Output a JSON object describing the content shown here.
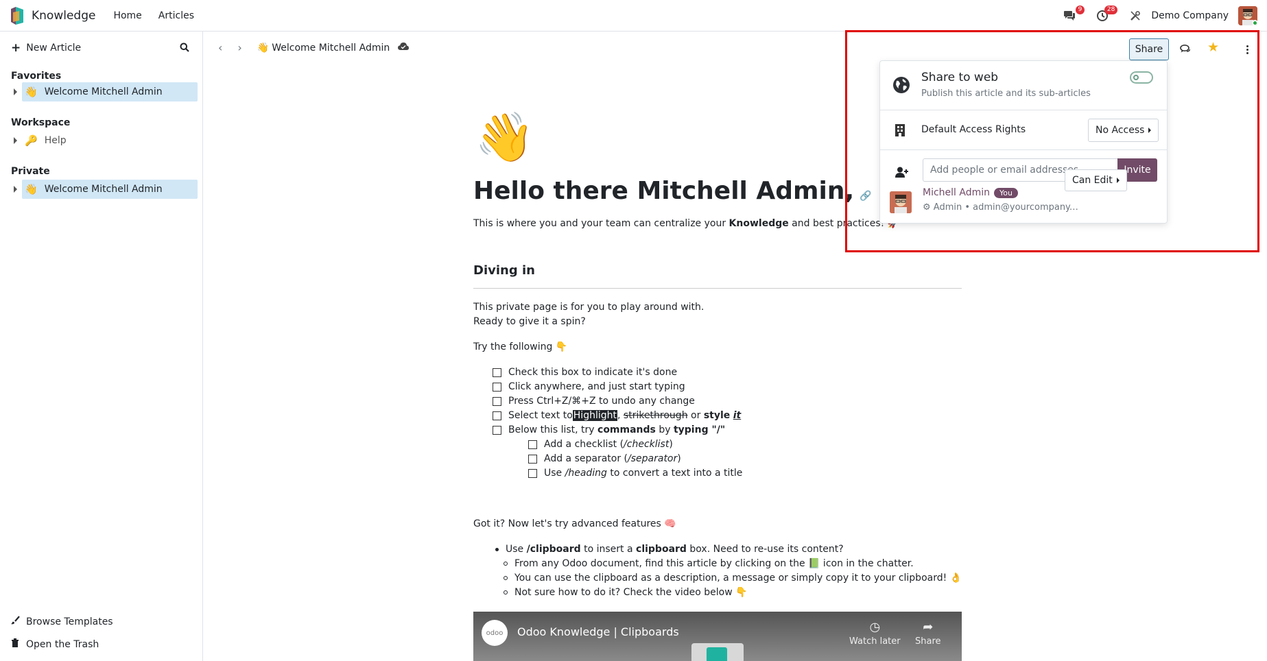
{
  "app": {
    "name": "Knowledge",
    "nav": [
      "Home",
      "Articles"
    ],
    "notifications": {
      "messages_count": "9",
      "activities_count": "28"
    },
    "company": "Demo Company"
  },
  "sidebar": {
    "new_article": "New Article",
    "sections": [
      {
        "title": "Favorites",
        "items": [
          {
            "emoji": "👋",
            "label": "Welcome Mitchell Admin",
            "active": true
          }
        ]
      },
      {
        "title": "Workspace",
        "items": [
          {
            "emoji": "🔑",
            "label": "Help",
            "active": false
          }
        ]
      },
      {
        "title": "Private",
        "items": [
          {
            "emoji": "👋",
            "label": "Welcome Mitchell Admin",
            "active": true
          }
        ]
      }
    ],
    "browse_templates": "Browse Templates",
    "open_trash": "Open the Trash"
  },
  "breadcrumb": {
    "emoji": "👋",
    "title": "Welcome Mitchell Admin"
  },
  "toolbar": {
    "share_label": "Share"
  },
  "share_popover": {
    "title": "Share to web",
    "subtitle": "Publish this article and its sub-articles",
    "share_enabled": false,
    "default_access_label": "Default Access Rights",
    "default_access_value": "No Access",
    "invite_placeholder": "Add people or email addresses...",
    "invite_button": "Invite",
    "member": {
      "name": "Michell Admin",
      "badge": "You",
      "meta": "Admin • admin@yourcompany.example.com",
      "permission": "Can Edit"
    }
  },
  "article": {
    "cover_emoji": "👋",
    "heading": "Hello there Mitchell Admin,",
    "intro_before": "This is where you and your team can centralize your ",
    "intro_bold": "Knowledge",
    "intro_after": " and best practices! 🚀",
    "section_heading": "Diving in",
    "para1": "This private page is for you to play around with.",
    "para2": "Ready to give it a spin?",
    "try_following": "Try the following 👇",
    "checklist": [
      "Check this box to indicate it's done",
      "Click anywhere, and just start typing",
      "Press Ctrl+Z/⌘+Z to undo any change"
    ],
    "select_row": {
      "prefix": "Select text to ",
      "highlight": "Highlight",
      "comma": ", ",
      "strike": "strikethrough",
      "or": " or ",
      "style_bold": "style",
      "style_it": "it"
    },
    "commands_row": {
      "prefix": "Below this list, try ",
      "commands": "commands",
      "by": " by ",
      "typing": "typing",
      "quote": " \"/\""
    },
    "sub_checklist": [
      {
        "prefix": "Add a checklist (",
        "em": "/checklist",
        "suffix": ")"
      },
      {
        "prefix": "Add a separator (",
        "em": "/separator",
        "suffix": ")"
      },
      {
        "prefix": "Use ",
        "em": "/heading",
        "suffix": " to convert a text into a title"
      }
    ],
    "advanced": "Got it? Now let's try advanced features 🧠",
    "clipboard_row": {
      "prefix": "Use ",
      "cmd": "/clipboard",
      "mid": " to insert a ",
      "word": "clipboard",
      "suffix": " box. Need to re-use its content?"
    },
    "sub_bullets": [
      "From any Odoo document, find this article by clicking on the 📗 icon in the chatter.",
      "You can use the clipboard as a description, a message or simply copy it to your clipboard! 👌",
      "Not sure how to do it? Check the video below 👇"
    ],
    "video": {
      "logo": "odoo",
      "title": "Odoo Knowledge | Clipboards",
      "watch_later": "Watch later",
      "share": "Share"
    }
  },
  "colors": {
    "accent": "#714b67",
    "active_item": "#d1e7f6",
    "highlight_frame": "#e00000",
    "star": "#f3b518"
  }
}
